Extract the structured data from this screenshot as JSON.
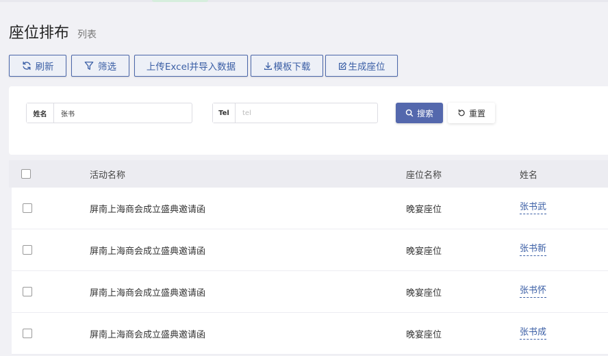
{
  "page": {
    "title": "座位排布",
    "subtitle": "列表"
  },
  "toolbar": {
    "refresh_label": "刷新",
    "filter_label": "筛选",
    "upload_label": "上传Excel并导入数据",
    "download_label": "模板下载",
    "generate_label": "生成座位"
  },
  "search": {
    "name_label": "姓名",
    "name_value": "张书",
    "tel_label": "Tel",
    "tel_placeholder": "tel",
    "search_label": "搜索",
    "reset_label": "重置"
  },
  "table": {
    "headers": {
      "activity": "活动名称",
      "seat": "座位名称",
      "name": "姓名"
    },
    "rows": [
      {
        "activity": "屏南上海商会成立盛典邀请函",
        "seat": "晚宴座位",
        "name": "张书武"
      },
      {
        "activity": "屏南上海商会成立盛典邀请函",
        "seat": "晚宴座位",
        "name": "张书新"
      },
      {
        "activity": "屏南上海商会成立盛典邀请函",
        "seat": "晚宴座位",
        "name": "张书怀"
      },
      {
        "activity": "屏南上海商会成立盛典邀请函",
        "seat": "晚宴座位",
        "name": "张书成"
      }
    ]
  },
  "colors": {
    "accent": "#3a5ea5",
    "primary_button": "#5468ad",
    "background": "#f1f1f5"
  }
}
